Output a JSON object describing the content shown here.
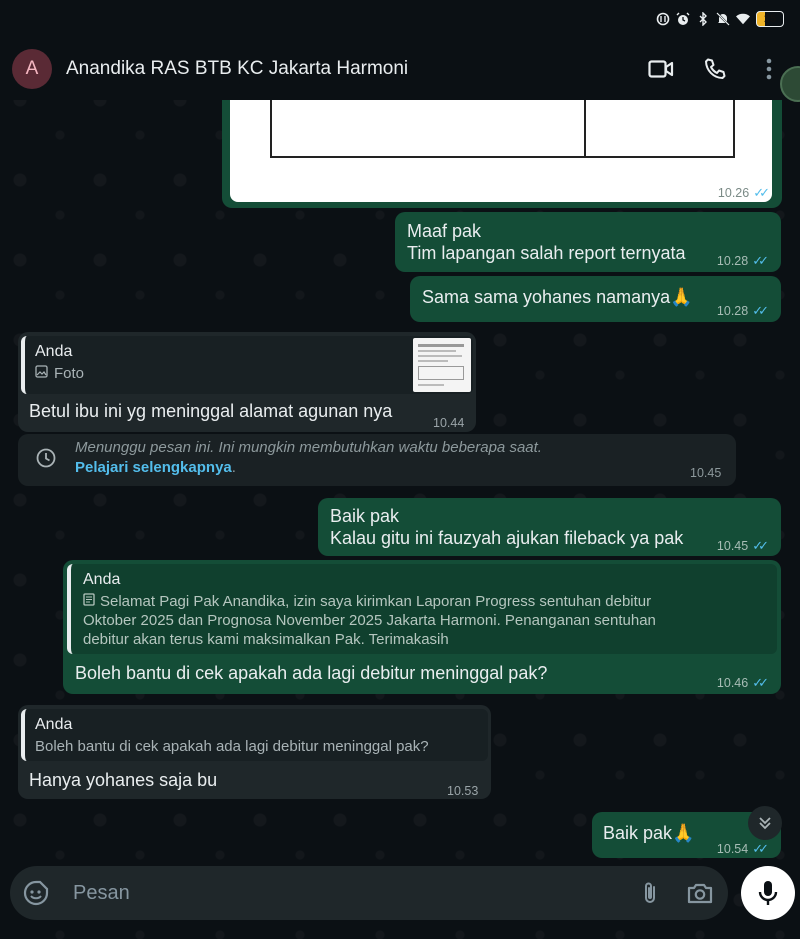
{
  "status": {
    "battery": "15"
  },
  "header": {
    "avatar_letter": "A",
    "title": "Anandika RAS BTB KC Jakarta Harmoni"
  },
  "messages": {
    "m0": {
      "time": "10.26"
    },
    "m1": {
      "line1": "Maaf pak",
      "line2": "Tim lapangan salah report ternyata",
      "time": "10.28"
    },
    "m2": {
      "text": "Sama sama yohanes namanya",
      "emoji": "🙏",
      "time": "10.28"
    },
    "m3": {
      "quote_author": "Anda",
      "quote_text": "Foto",
      "text": "Betul ibu ini yg meninggal alamat agunan nya",
      "time": "10.44"
    },
    "system": {
      "text": "Menunggu pesan ini. Ini mungkin membutuhkan waktu beberapa saat.",
      "link": "Pelajari selengkapnya",
      "time": "10.45"
    },
    "m4": {
      "line1": "Baik pak",
      "line2": "Kalau gitu ini fauzyah ajukan fileback ya pak",
      "time": "10.45"
    },
    "m5": {
      "quote_author": "Anda",
      "quote_line1": "Selamat Pagi Pak Anandika, izin saya kirimkan Laporan Progress sentuhan debitur",
      "quote_line2": "Oktober 2025 dan Prognosa November 2025 Jakarta Harmoni. Penanganan sentuhan",
      "quote_line3": "debitur akan terus kami maksimalkan Pak. Terimakasih",
      "text": "Boleh bantu di cek apakah ada lagi debitur meninggal pak?",
      "time": "10.46"
    },
    "m6": {
      "quote_author": "Anda",
      "quote_text": "Boleh bantu di cek apakah ada lagi debitur meninggal pak?",
      "text": "Hanya yohanes saja bu",
      "time": "10.53"
    },
    "m7": {
      "text": "Baik pak",
      "emoji": "🙏",
      "time": "10.54"
    }
  },
  "composer": {
    "placeholder": "Pesan"
  },
  "colors": {
    "outgoing": "#144d37",
    "incoming": "#1f272a",
    "ticks": "#53bdeb",
    "background": "#0b1014"
  },
  "icons": [
    "video-call-icon",
    "phone-icon",
    "more-icon",
    "sticker-icon",
    "attach-icon",
    "camera-icon",
    "mic-icon",
    "clock-icon",
    "scroll-down-icon"
  ]
}
